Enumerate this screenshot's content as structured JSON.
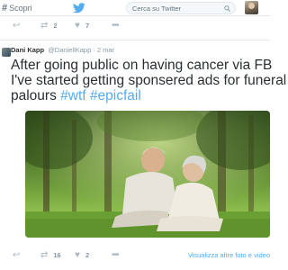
{
  "topbar": {
    "discover_label": "Scopri",
    "search_placeholder": "Cerca su Twitter"
  },
  "prev_tweet": {
    "retweet_count": "2",
    "like_count": "7"
  },
  "tweet": {
    "name": "Dani Kapp",
    "handle_date": "@DaniellKapp · 2 mar",
    "line1": "After going public on having cancer via FB",
    "line2": "I've started getting sponsered ads for funeral",
    "line3_prefix": "palours ",
    "hashtag1": "#wtf",
    "hashtag2": "#epicfail",
    "retweet_count": "16",
    "like_count": "2",
    "more_media": "Visualizza altre foto e video"
  },
  "colors": {
    "link": "#55acee",
    "muted": "#8899a6",
    "text": "#292f33"
  }
}
